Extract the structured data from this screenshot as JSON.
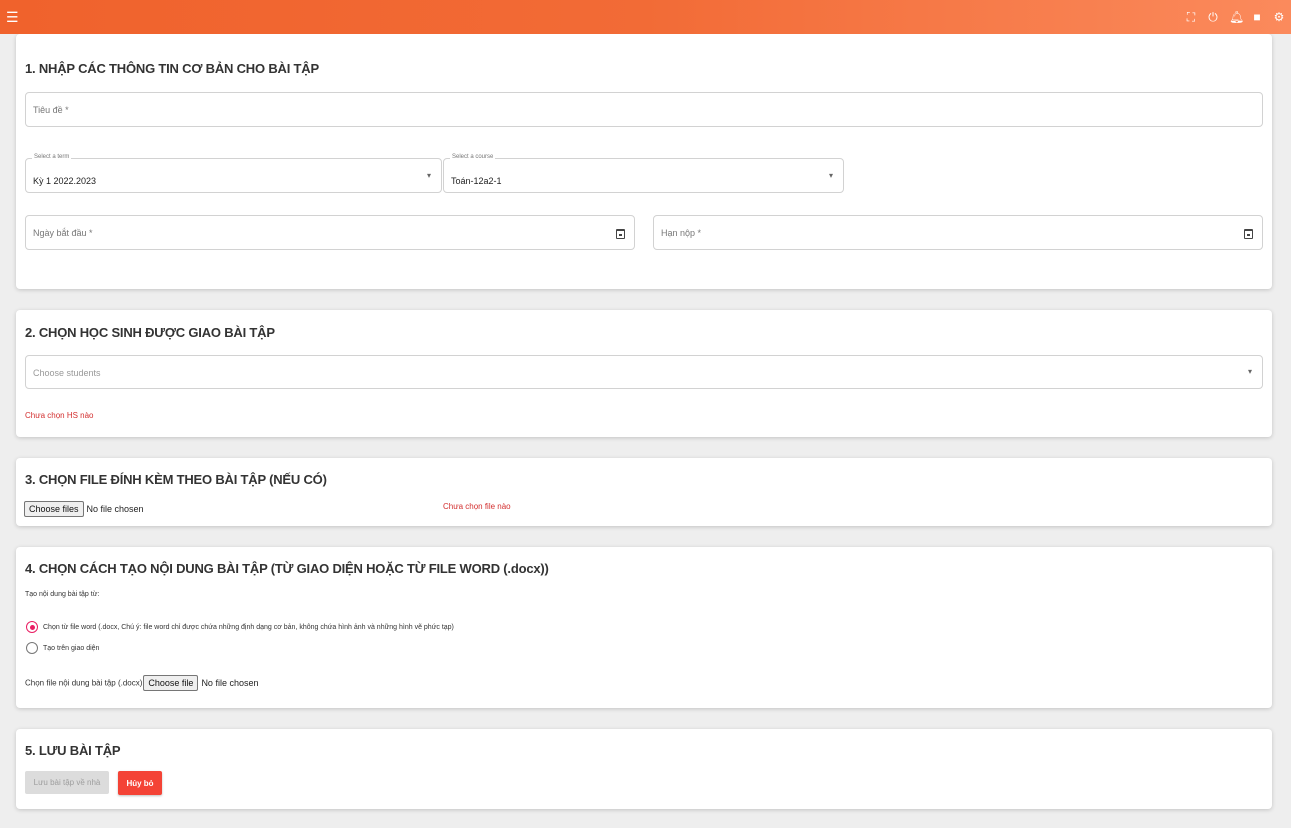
{
  "topbar": {
    "icons": [
      "menu-icon",
      "fullscreen-icon",
      "power-icon",
      "bell-icon",
      "chat-icon",
      "gear-icon"
    ],
    "accent_color": "#f26b36"
  },
  "section1": {
    "title": "1. NHẬP CÁC THÔNG TIN CƠ BẢN CHO BÀI TẬP",
    "title_field_placeholder": "Tiêu đề *",
    "term_select": {
      "legend": "Select a term",
      "value": "Kỳ 1 2022.2023"
    },
    "course_select": {
      "legend": "Select a course",
      "value": "Toán-12a2-1"
    },
    "start_date_placeholder": "Ngày bắt đầu *",
    "due_date_placeholder": "Hạn nộp *"
  },
  "section2": {
    "title": "2. CHỌN HỌC SINH ĐƯỢC GIAO BÀI TẬP",
    "students_placeholder": "Choose students",
    "warning": "Chưa chọn HS nào"
  },
  "section3": {
    "title": "3. CHỌN FILE ĐÍNH KÈM THEO BÀI TẬP (NẾU CÓ)",
    "file_button": "Choose files",
    "file_status": "No file chosen",
    "warning": "Chưa chọn file nào"
  },
  "section4": {
    "title": "4. CHỌN CÁCH TẠO NỘI DUNG BÀI TẬP (TỪ GIAO DIỆN HOẶC TỪ FILE WORD (.docx))",
    "subtitle": "Tạo nội dung bài tập từ:",
    "option_word": "Chọn từ file word (.docx, Chú ý: file word chỉ được chứa những định dạng cơ bản, không chứa hình ảnh và những hình vẽ phức tạp)",
    "option_ui": "Tạo trên giao diện",
    "file_label": "Chọn file nội dung bài tập (.docx)",
    "file_button": "Choose file",
    "file_status": "No file chosen"
  },
  "section5": {
    "title": "5. LƯU BÀI TẬP",
    "save_button": "Lưu bài tập về nhà",
    "cancel_button": "Hủy bỏ"
  }
}
